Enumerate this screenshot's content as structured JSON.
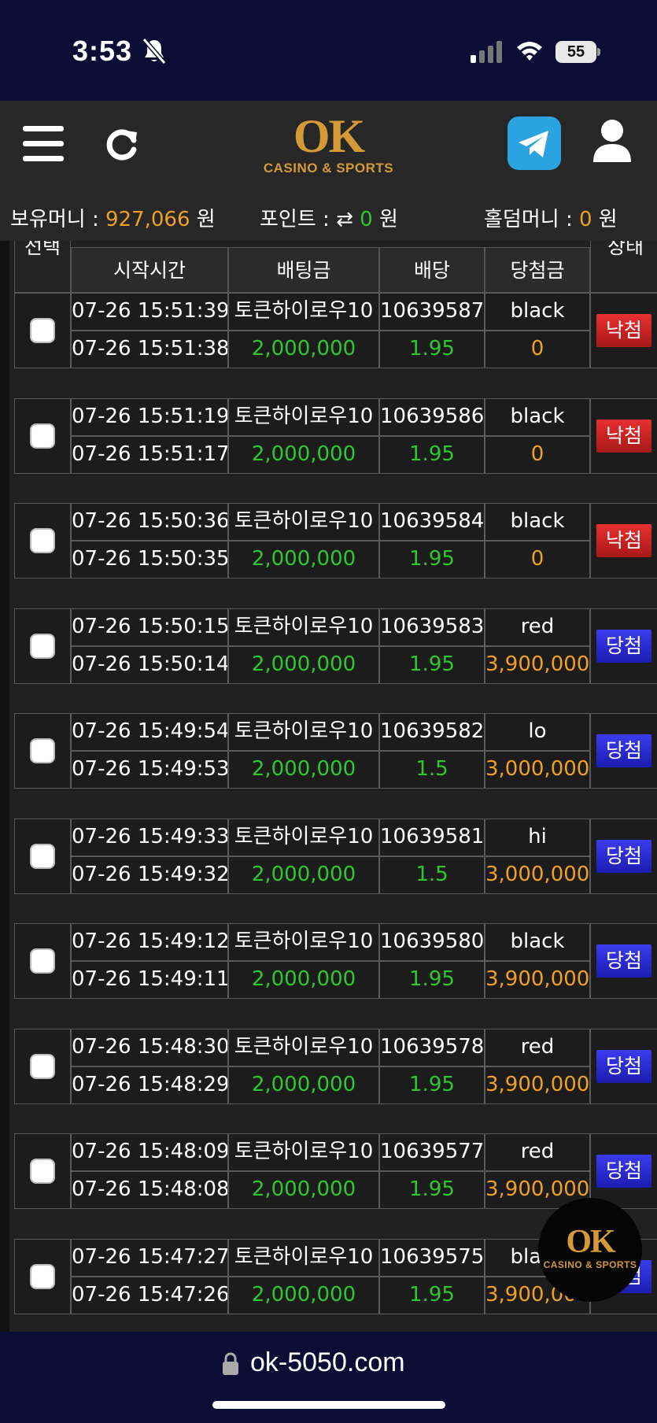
{
  "status_bar": {
    "time": "3:53",
    "battery": "55"
  },
  "header": {
    "logo_main": "OK",
    "logo_sub": "CASINO & SPORTS"
  },
  "balance": {
    "money_label": "보유머니 :",
    "money_value": "927,066",
    "money_unit": "원",
    "point_label": "포인트 :",
    "point_value": "0",
    "point_unit": "원",
    "holdem_label": "홀덤머니 :",
    "holdem_value": "0",
    "holdem_unit": "원"
  },
  "table": {
    "headers": {
      "select": "선택",
      "start_time": "시작시간",
      "bet_amount": "배팅금",
      "odds": "배당",
      "win_amount": "당첨금",
      "status": "상태"
    },
    "rows": [
      {
        "time1": "07-26 15:51:39",
        "game": "토큰하이로우10",
        "round": "10639587",
        "pick": "black",
        "time2": "07-26 15:51:38",
        "amount": "2,000,000",
        "odds": "1.95",
        "win": "0",
        "status": "낙첨",
        "result": "lose"
      },
      {
        "time1": "07-26 15:51:19",
        "game": "토큰하이로우10",
        "round": "10639586",
        "pick": "black",
        "time2": "07-26 15:51:17",
        "amount": "2,000,000",
        "odds": "1.95",
        "win": "0",
        "status": "낙첨",
        "result": "lose"
      },
      {
        "time1": "07-26 15:50:36",
        "game": "토큰하이로우10",
        "round": "10639584",
        "pick": "black",
        "time2": "07-26 15:50:35",
        "amount": "2,000,000",
        "odds": "1.95",
        "win": "0",
        "status": "낙첨",
        "result": "lose"
      },
      {
        "time1": "07-26 15:50:15",
        "game": "토큰하이로우10",
        "round": "10639583",
        "pick": "red",
        "time2": "07-26 15:50:14",
        "amount": "2,000,000",
        "odds": "1.95",
        "win": "3,900,000",
        "status": "당첨",
        "result": "win"
      },
      {
        "time1": "07-26 15:49:54",
        "game": "토큰하이로우10",
        "round": "10639582",
        "pick": "lo",
        "time2": "07-26 15:49:53",
        "amount": "2,000,000",
        "odds": "1.5",
        "win": "3,000,000",
        "status": "당첨",
        "result": "win"
      },
      {
        "time1": "07-26 15:49:33",
        "game": "토큰하이로우10",
        "round": "10639581",
        "pick": "hi",
        "time2": "07-26 15:49:32",
        "amount": "2,000,000",
        "odds": "1.5",
        "win": "3,000,000",
        "status": "당첨",
        "result": "win"
      },
      {
        "time1": "07-26 15:49:12",
        "game": "토큰하이로우10",
        "round": "10639580",
        "pick": "black",
        "time2": "07-26 15:49:11",
        "amount": "2,000,000",
        "odds": "1.95",
        "win": "3,900,000",
        "status": "당첨",
        "result": "win"
      },
      {
        "time1": "07-26 15:48:30",
        "game": "토큰하이로우10",
        "round": "10639578",
        "pick": "red",
        "time2": "07-26 15:48:29",
        "amount": "2,000,000",
        "odds": "1.95",
        "win": "3,900,000",
        "status": "당첨",
        "result": "win"
      },
      {
        "time1": "07-26 15:48:09",
        "game": "토큰하이로우10",
        "round": "10639577",
        "pick": "red",
        "time2": "07-26 15:48:08",
        "amount": "2,000,000",
        "odds": "1.95",
        "win": "3,900,000",
        "status": "당첨",
        "result": "win"
      },
      {
        "time1": "07-26 15:47:27",
        "game": "토큰하이로우10",
        "round": "10639575",
        "pick": "black",
        "time2": "07-26 15:47:26",
        "amount": "2,000,000",
        "odds": "1.95",
        "win": "3,900,000",
        "status": "당첨",
        "result": "win"
      }
    ]
  },
  "floating_logo": {
    "main": "OK",
    "sub": "CASINO & SPORTS"
  },
  "url_bar": {
    "url": "ok-5050.com"
  }
}
